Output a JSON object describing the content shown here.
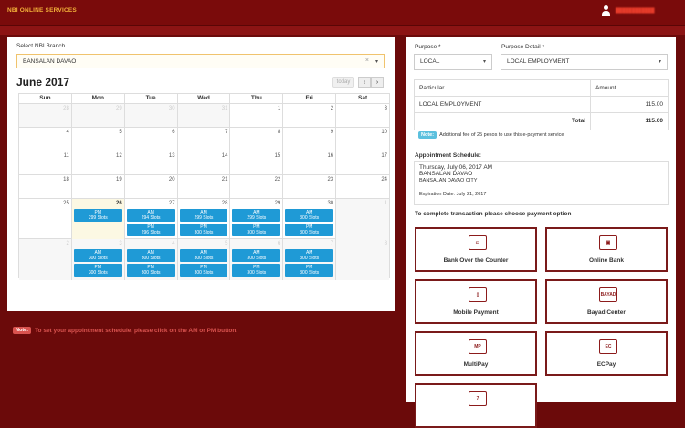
{
  "header": {
    "brand": "NBI ONLINE SERVICES"
  },
  "branch": {
    "label": "Select NBI Branch",
    "value": "BANSALAN DAVAO"
  },
  "calendar": {
    "title": "June 2017",
    "today_label": "today",
    "prev": "‹",
    "next": "›",
    "days": [
      "Sun",
      "Mon",
      "Tue",
      "Wed",
      "Thu",
      "Fri",
      "Sat"
    ],
    "weeks": [
      [
        {
          "d": "28",
          "o": true
        },
        {
          "d": "29",
          "o": true
        },
        {
          "d": "30",
          "o": true
        },
        {
          "d": "31",
          "o": true
        },
        {
          "d": "1"
        },
        {
          "d": "2"
        },
        {
          "d": "3"
        }
      ],
      [
        {
          "d": "4"
        },
        {
          "d": "5"
        },
        {
          "d": "6"
        },
        {
          "d": "7"
        },
        {
          "d": "8"
        },
        {
          "d": "9"
        },
        {
          "d": "10"
        }
      ],
      [
        {
          "d": "11"
        },
        {
          "d": "12"
        },
        {
          "d": "13"
        },
        {
          "d": "14"
        },
        {
          "d": "15"
        },
        {
          "d": "16"
        },
        {
          "d": "17"
        }
      ],
      [
        {
          "d": "18"
        },
        {
          "d": "19"
        },
        {
          "d": "20"
        },
        {
          "d": "21"
        },
        {
          "d": "22"
        },
        {
          "d": "23"
        },
        {
          "d": "24"
        }
      ],
      [
        {
          "d": "25"
        },
        {
          "d": "26",
          "t": true,
          "slots": [
            [
              "PM",
              "299 Slots"
            ]
          ]
        },
        {
          "d": "27",
          "slots": [
            [
              "AM",
              "294 Slots"
            ],
            [
              "PM",
              "296 Slots"
            ]
          ]
        },
        {
          "d": "28",
          "slots": [
            [
              "AM",
              "299 Slots"
            ],
            [
              "PM",
              "300 Slots"
            ]
          ]
        },
        {
          "d": "29",
          "slots": [
            [
              "AM",
              "299 Slots"
            ],
            [
              "PM",
              "300 Slots"
            ]
          ]
        },
        {
          "d": "30",
          "slots": [
            [
              "AM",
              "300 Slots"
            ],
            [
              "PM",
              "300 Slots"
            ]
          ]
        },
        {
          "d": "1",
          "o": true
        }
      ],
      [
        {
          "d": "2",
          "o": true
        },
        {
          "d": "3",
          "o": true,
          "slots": [
            [
              "AM",
              "300 Slots"
            ],
            [
              "PM",
              "300 Slots"
            ]
          ]
        },
        {
          "d": "4",
          "o": true,
          "slots": [
            [
              "AM",
              "300 Slots"
            ],
            [
              "PM",
              "300 Slots"
            ]
          ]
        },
        {
          "d": "5",
          "o": true,
          "slots": [
            [
              "AM",
              "300 Slots"
            ],
            [
              "PM",
              "300 Slots"
            ]
          ]
        },
        {
          "d": "6",
          "o": true,
          "slots": [
            [
              "AM",
              "300 Slots"
            ],
            [
              "PM",
              "300 Slots"
            ]
          ]
        },
        {
          "d": "7",
          "o": true,
          "slots": [
            [
              "AM",
              "300 Slots"
            ],
            [
              "PM",
              "300 Slots"
            ]
          ]
        },
        {
          "d": "8",
          "o": true
        }
      ]
    ]
  },
  "note_left": {
    "badge": "Note:",
    "text": "To set your appointment schedule, please click on the AM or PM button."
  },
  "purpose": {
    "label": "Purpose *",
    "value": "LOCAL"
  },
  "purpose_detail": {
    "label": "Purpose Detail *",
    "value": "LOCAL EMPLOYMENT"
  },
  "particulars": {
    "col1": "Particular",
    "col2": "Amount",
    "item": "LOCAL EMPLOYMENT",
    "item_amount": "115.00",
    "total_label": "Total",
    "total": "115.00"
  },
  "fee_note": {
    "badge": "Note:",
    "text": "Additional fee of 25 pesos to use this e-payment service"
  },
  "appointment": {
    "label": "Appointment Schedule:",
    "date": "Thursday, July 06, 2017 AM",
    "branch": "BANSALAN DAVAO",
    "city": "BANSALAN DAVAO CITY",
    "expiration": "Expiration Date: July 21, 2017"
  },
  "payment": {
    "title": "To complete transaction please choose payment option",
    "options": [
      {
        "label": "Bank Over the Counter",
        "icon": "bank-counter-icon",
        "glyph": "▭"
      },
      {
        "label": "Online Bank",
        "icon": "online-bank-icon",
        "glyph": "▣"
      },
      {
        "label": "Mobile Payment",
        "icon": "mobile-payment-icon",
        "glyph": "▯"
      },
      {
        "label": "Bayad Center",
        "icon": "bayad-center-icon",
        "glyph": "BAYAD"
      },
      {
        "label": "MultiPay",
        "icon": "multipay-icon",
        "glyph": "MP"
      },
      {
        "label": "ECPay",
        "icon": "ecpay-icon",
        "glyph": "EC"
      },
      {
        "label": "",
        "icon": "seven-eleven-icon",
        "glyph": "7"
      }
    ]
  }
}
